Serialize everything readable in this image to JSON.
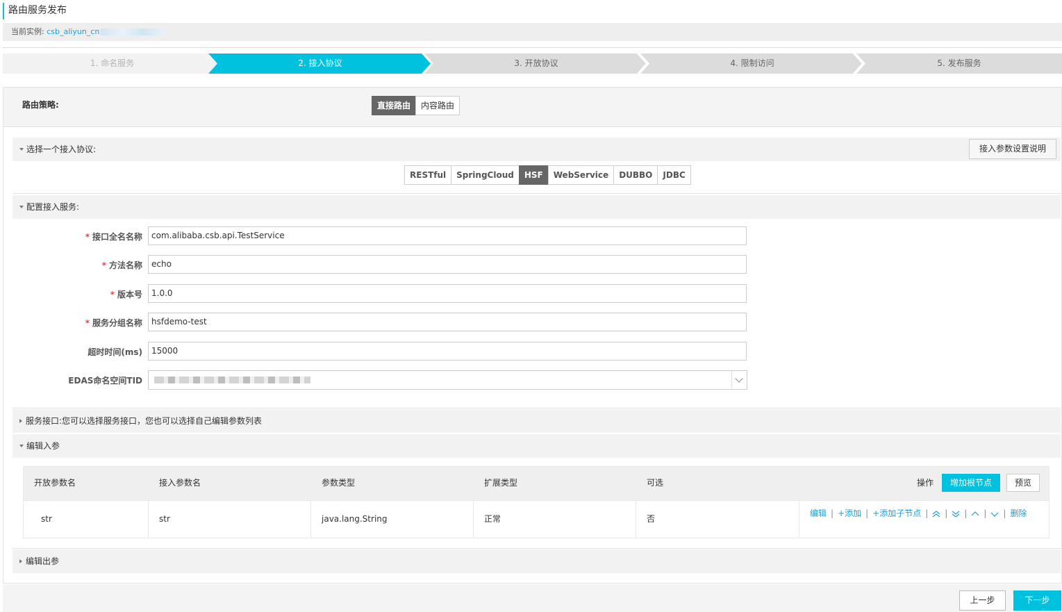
{
  "page": {
    "title": "路由服务发布",
    "instance_label": "当前实例:",
    "instance_value": "csb_aliyun_cn"
  },
  "steps": [
    {
      "label": "1. 命名服务",
      "state": "done"
    },
    {
      "label": "2. 接入协议",
      "state": "active"
    },
    {
      "label": "3. 开放协议",
      "state": "todo"
    },
    {
      "label": "4. 限制访问",
      "state": "todo"
    },
    {
      "label": "5. 发布服务",
      "state": "todo"
    }
  ],
  "strategy": {
    "label": "路由策略:",
    "options": [
      "直接路由",
      "内容路由"
    ],
    "selected": "直接路由"
  },
  "protocol_section": {
    "title": "选择一个接入协议:",
    "help_button": "接入参数设置说明",
    "options": [
      "RESTful",
      "SpringCloud",
      "HSF",
      "WebService",
      "DUBBO",
      "JDBC"
    ],
    "selected": "HSF"
  },
  "config_section": {
    "title": "配置接入服务:",
    "fields": [
      {
        "label": "接口全名名称",
        "required": true,
        "value": "com.alibaba.csb.api.TestService"
      },
      {
        "label": "方法名称",
        "required": true,
        "value": "echo"
      },
      {
        "label": "版本号",
        "required": true,
        "value": "1.0.0"
      },
      {
        "label": "服务分组名称",
        "required": true,
        "value": "hsfdemo-test"
      },
      {
        "label": "超时时间(ms)",
        "required": false,
        "value": "15000"
      },
      {
        "label": "EDAS命名空间TID",
        "required": false,
        "value": ""
      }
    ]
  },
  "service_interface_section": {
    "title": "服务接口:您可以选择服务接口，您也可以选择自己编辑参数列表"
  },
  "input_params_section": {
    "title": "编辑入参",
    "columns": [
      "开放参数名",
      "接入参数名",
      "参数类型",
      "扩展类型",
      "可选",
      "操作"
    ],
    "add_root_button": "增加根节点",
    "preview_button": "预览",
    "rows": [
      {
        "open_name": "str",
        "access_name": "str",
        "type": "java.lang.String",
        "ext_type": "正常",
        "optional": "否"
      }
    ],
    "row_actions": {
      "edit": "编辑",
      "add": "+添加",
      "add_child": "+添加子节点",
      "delete": "删除"
    }
  },
  "output_params_section": {
    "title": "编辑出参"
  },
  "footer": {
    "prev_button": "上一步",
    "next_button": "下一步"
  },
  "colors": {
    "accent": "#00c1de",
    "link": "#1e9ed6",
    "required": "#e64340"
  }
}
